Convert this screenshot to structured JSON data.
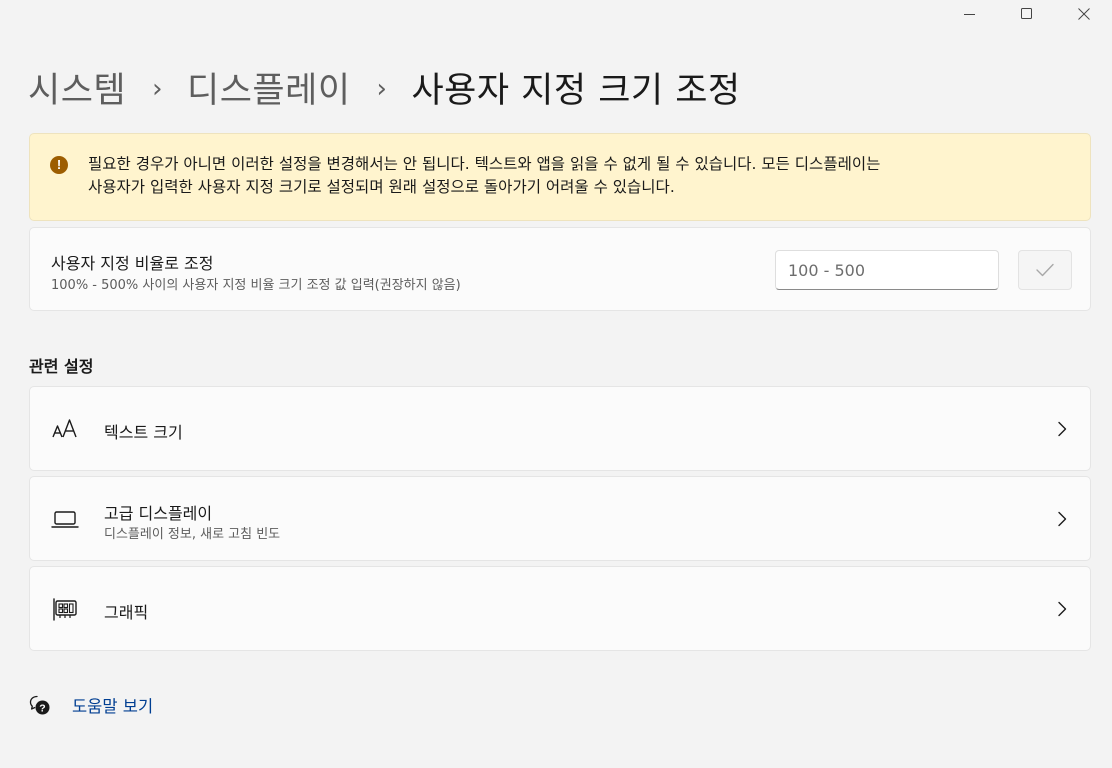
{
  "window": {
    "minimize_icon": "minimize-icon",
    "maximize_icon": "maximize-icon",
    "close_icon": "close-icon"
  },
  "breadcrumb": {
    "items": [
      "시스템",
      "디스플레이"
    ],
    "separator": "›",
    "current": "사용자 지정 크기 조정"
  },
  "warning": {
    "icon": "warning-icon",
    "text_line1": "필요한 경우가 아니면 이러한 설정을 변경해서는 안 됩니다. 텍스트와 앱을 읽을 수 없게 될 수 있습니다. 모든 디스플레이는",
    "text_line2": "사용자가 입력한 사용자 지정 크기로 설정되며 원래 설정으로 돌아가기 어려울 수 있습니다."
  },
  "custom_scale": {
    "title": "사용자 지정 비율로 조정",
    "description": "100% - 500% 사이의 사용자 지정 비율 크기 조정 값 입력(권장하지 않음)",
    "input_placeholder": "100 - 500",
    "input_value": "",
    "apply_icon": "checkmark-icon"
  },
  "related": {
    "section_title": "관련 설정",
    "items": [
      {
        "title": "텍스트 크기",
        "subtitle": "",
        "icon": "text-size-icon"
      },
      {
        "title": "고급 디스플레이",
        "subtitle": "디스플레이 정보, 새로 고침 빈도",
        "icon": "laptop-icon"
      },
      {
        "title": "그래픽",
        "subtitle": "",
        "icon": "graphics-card-icon"
      }
    ],
    "chevron_icon": "chevron-right-icon"
  },
  "help": {
    "label": "도움말 보기",
    "icon": "help-chat-icon"
  },
  "colors": {
    "background": "#f3f3f3",
    "card": "#fbfbfb",
    "warning_bg": "#fff4ce",
    "warning_icon": "#9d5d00",
    "link": "#003e92"
  }
}
